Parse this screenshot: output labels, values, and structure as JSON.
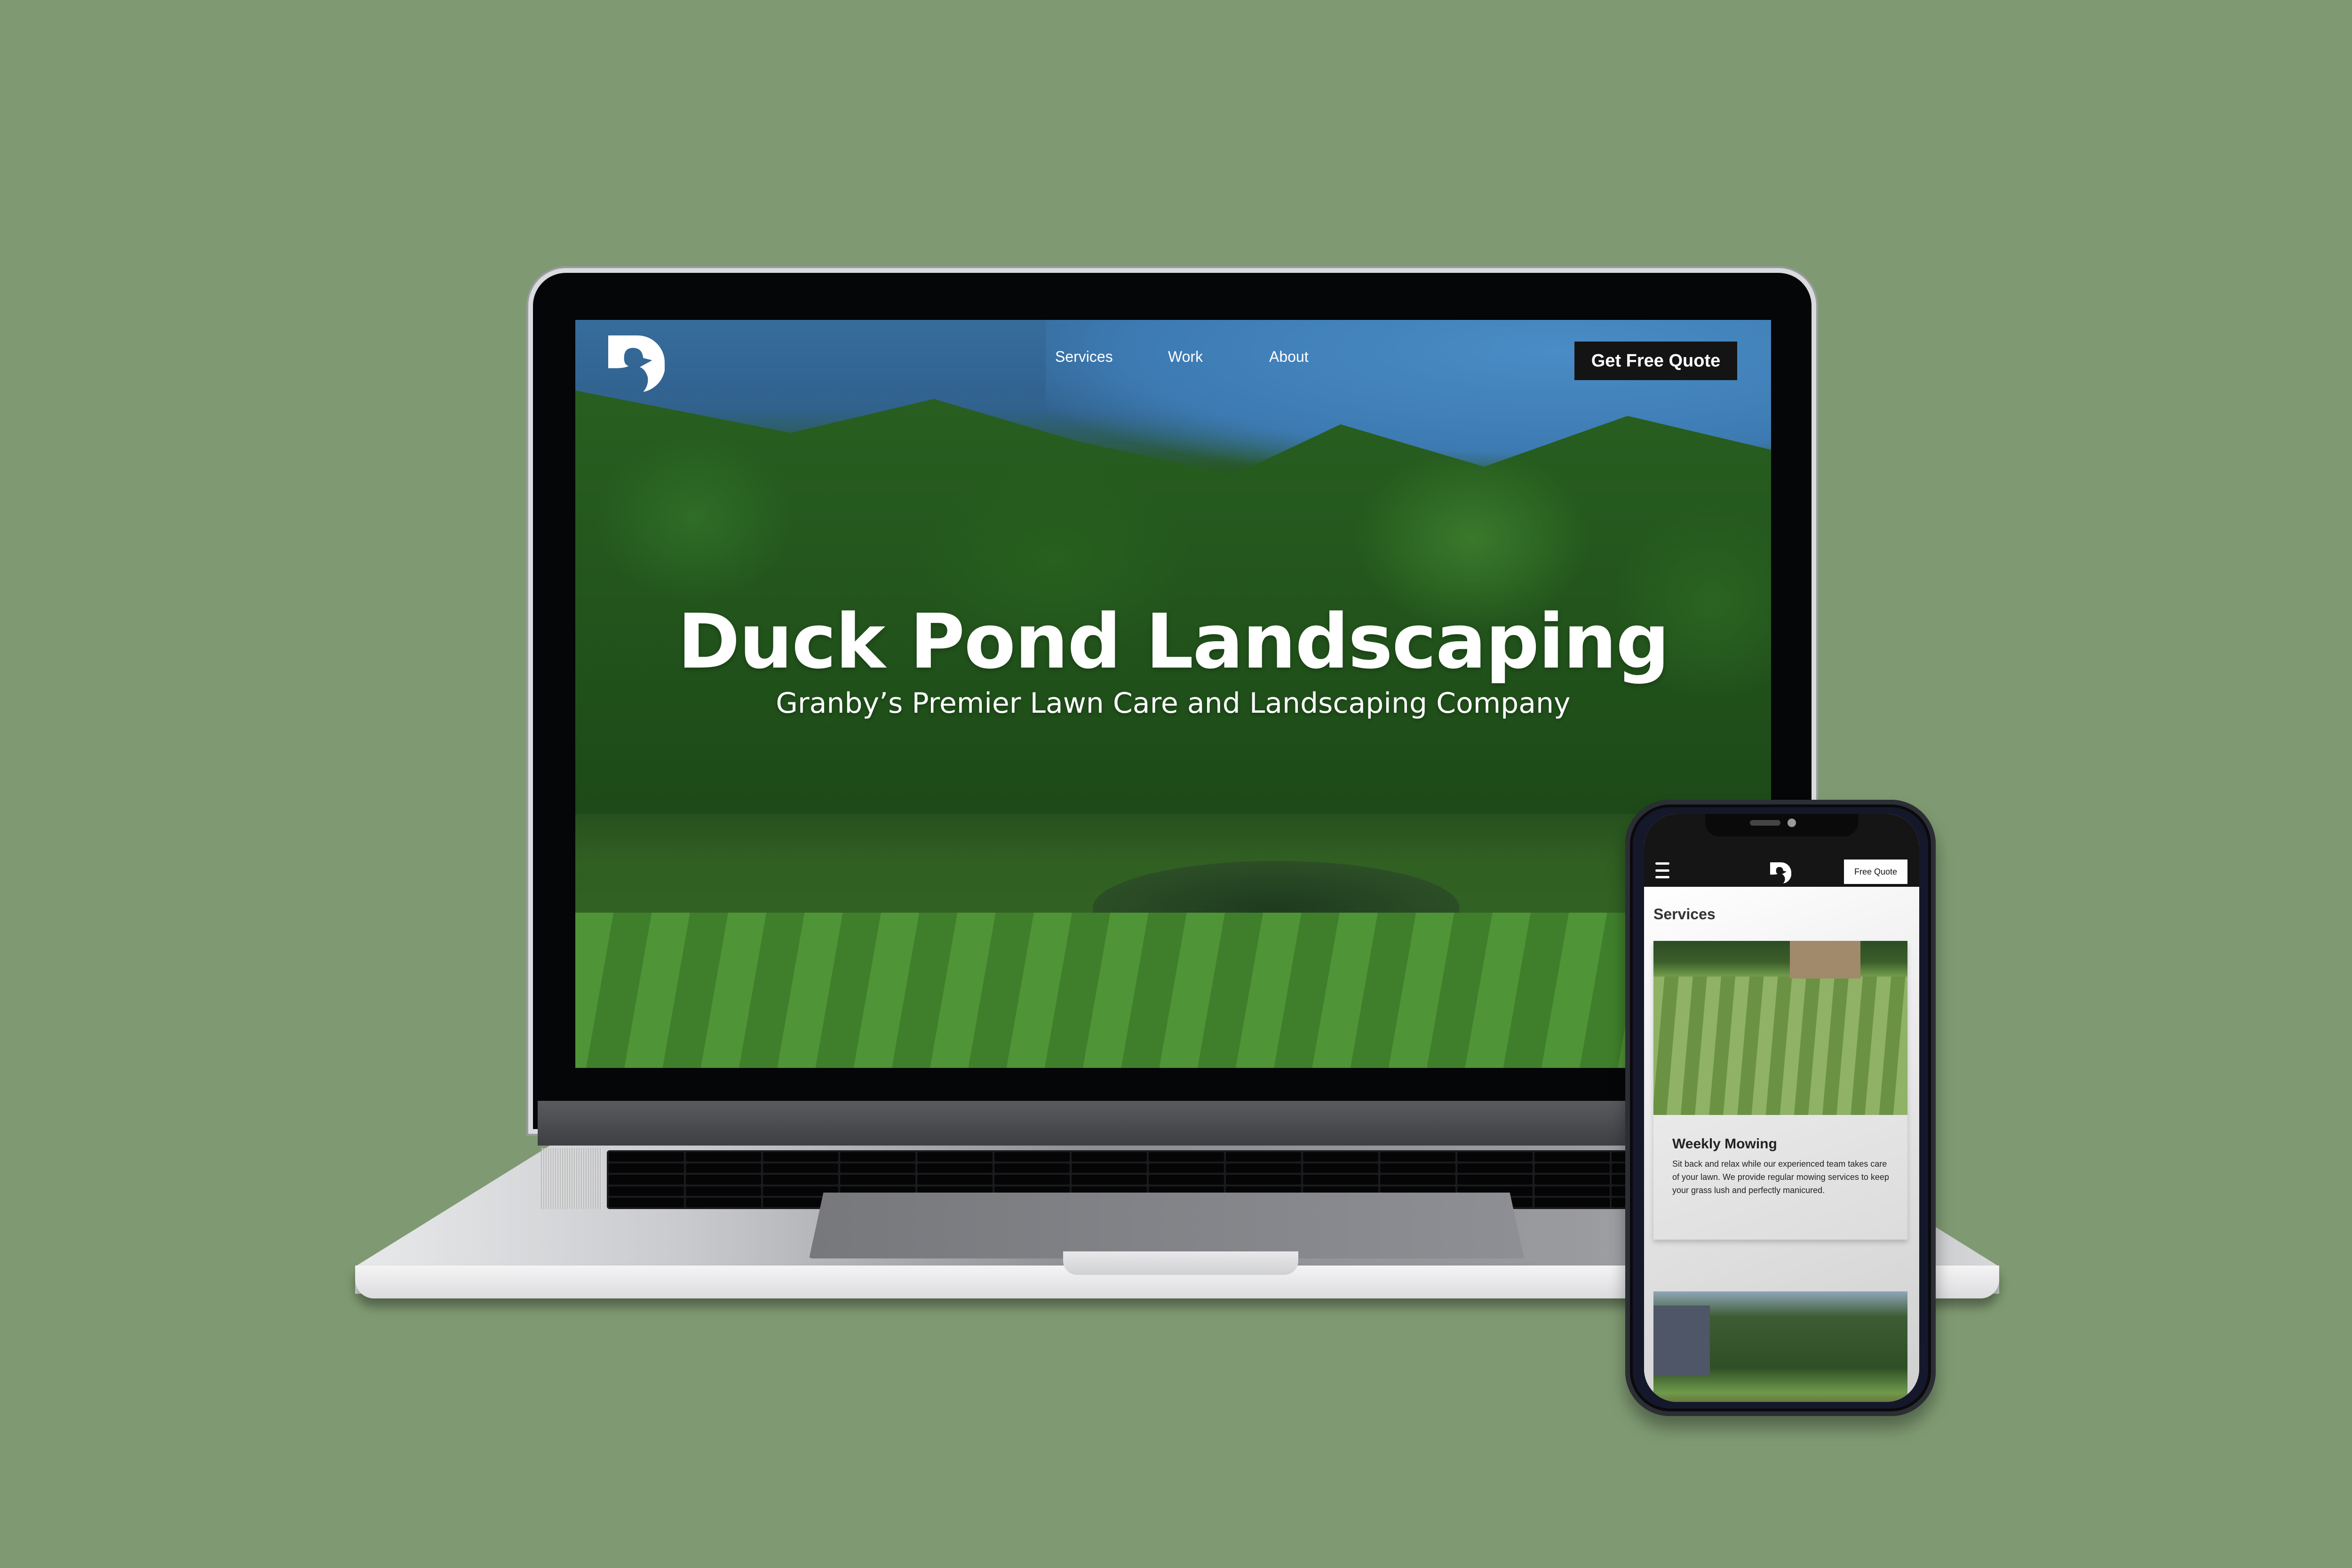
{
  "desktop_site": {
    "nav": {
      "logo_icon": "duck-logo-icon",
      "links": [
        "Services",
        "Work",
        "About"
      ],
      "cta_label": "Get Free Quote"
    },
    "hero": {
      "title": "Duck Pond Landscaping",
      "subtitle": "Granby’s Premier Lawn Care and Landscaping Company"
    }
  },
  "mobile_site": {
    "header": {
      "menu_icon": "hamburger-menu-icon",
      "logo_icon": "duck-logo-icon",
      "cta_label": "Free Quote"
    },
    "services": {
      "heading": "Services",
      "cards": [
        {
          "title": "Weekly Mowing",
          "description": "Sit back and relax while our experienced team takes care of your lawn. We provide regular mowing services to keep your grass lush and perfectly manicured."
        }
      ]
    }
  },
  "colors": {
    "background": "#7f9a72",
    "cta_background": "#141414",
    "mobile_header": "#151515"
  }
}
